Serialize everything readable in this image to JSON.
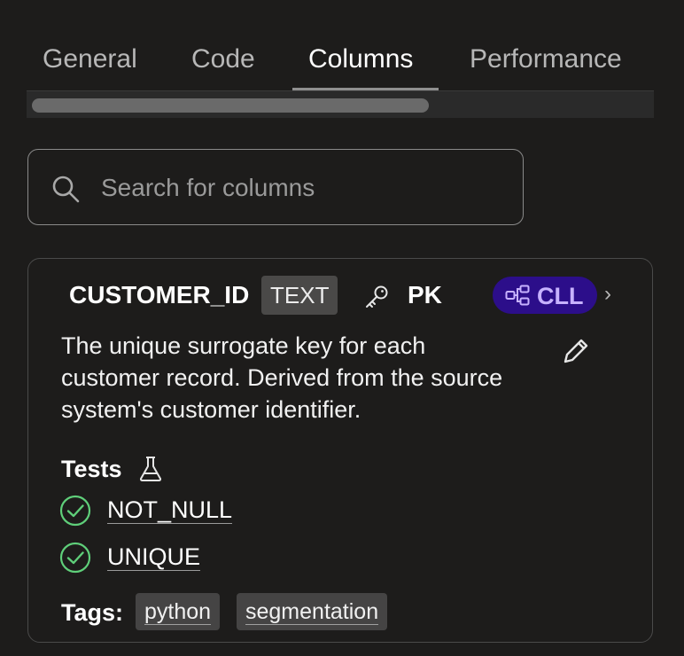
{
  "tabs": [
    {
      "label": "General",
      "active": false
    },
    {
      "label": "Code",
      "active": false
    },
    {
      "label": "Columns",
      "active": true
    },
    {
      "label": "Performance",
      "active": false
    }
  ],
  "search": {
    "placeholder": "Search for columns",
    "value": ""
  },
  "column": {
    "name": "CUSTOMER_ID",
    "type": "TEXT",
    "key_label": "PK",
    "lineage_label": "CLL",
    "description": "The unique surrogate key for each customer record. Derived from the source system's customer identifier.",
    "tests_title": "Tests",
    "tests": [
      {
        "name": "NOT_NULL",
        "status": "passed"
      },
      {
        "name": "UNIQUE",
        "status": "passed"
      }
    ],
    "tags_label": "Tags:",
    "tags": [
      "python",
      "segmentation"
    ]
  },
  "colors": {
    "background": "#1d1c1b",
    "lineage_badge_bg": "#2c0e8a",
    "lineage_badge_text": "#c7b2ff",
    "test_pass": "#5fcf7a"
  },
  "icons": {
    "search": "search-icon",
    "key": "key-icon",
    "lineage": "lineage-icon",
    "edit": "pencil-icon",
    "tests": "flask-icon",
    "test_status": "check-circle-icon"
  }
}
